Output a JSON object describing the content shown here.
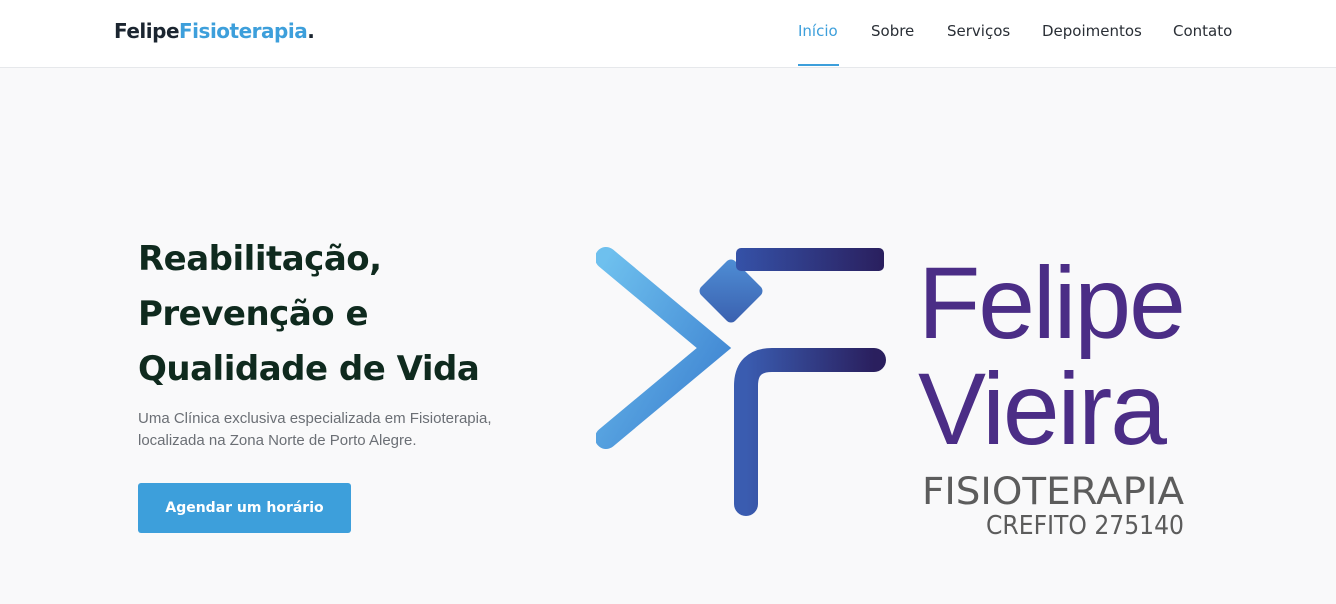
{
  "brand": {
    "part1": "Felipe",
    "part2": "Fisioterapia",
    "part3": "."
  },
  "nav": {
    "items": [
      {
        "label": "Início",
        "active": true
      },
      {
        "label": "Sobre"
      },
      {
        "label": "Serviços"
      },
      {
        "label": "Depoimentos"
      },
      {
        "label": "Contato"
      }
    ]
  },
  "hero": {
    "title_lines": [
      "Reabilitação,",
      "Prevenção e",
      "Qualidade de Vida"
    ],
    "subtitle_lines": [
      "Uma Clínica exclusiva especializada em Fisioterapia,",
      "localizada na Zona Norte de Porto Alegre."
    ],
    "cta_label": "Agendar um horário"
  },
  "logo": {
    "name_line1": "Felipe",
    "name_line2": "Vieira",
    "tagline": "FISIOTERAPIA",
    "registration": "CREFITO 275140"
  },
  "colors": {
    "accent": "#3d9fdb",
    "title": "#0f2a1e",
    "logo_purple": "#4b2d86",
    "logo_gray": "#5c5c5c",
    "logo_blue_light": "#6bb8ea",
    "logo_blue_dark": "#2f3f8f"
  }
}
